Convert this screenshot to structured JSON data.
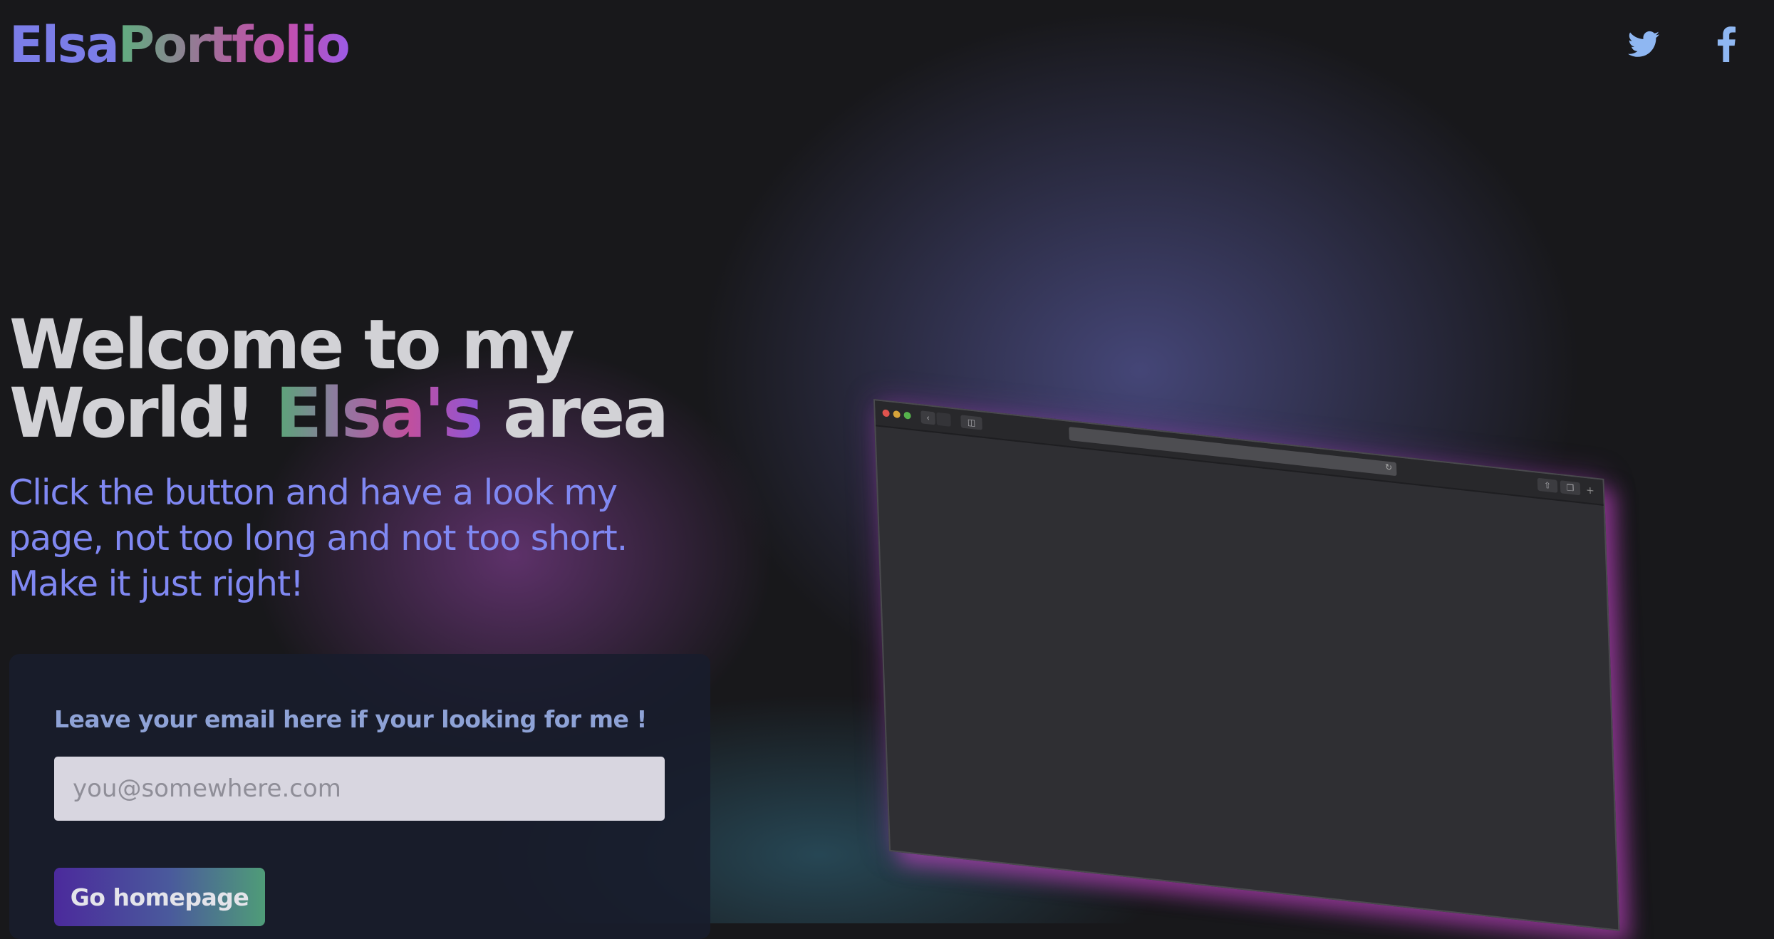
{
  "header": {
    "logo_part1": "Elsa",
    "logo_part2": "Portfolio",
    "social": [
      {
        "name": "twitter",
        "icon": "twitter-bird-icon"
      },
      {
        "name": "facebook",
        "icon": "facebook-f-icon"
      }
    ]
  },
  "hero": {
    "title_line1": "Welcome to my",
    "title_line2_prefix": "World! ",
    "title_highlight": "Elsa's",
    "title_line2_suffix": " area",
    "subtitle": "Click the button and have a look my page, not too long and not too short. Make it just right!"
  },
  "signup": {
    "label": "Leave your email here if your looking for me !",
    "email_placeholder": "you@somewhere.com",
    "email_value": "",
    "button_label": "Go homepage"
  },
  "colors": {
    "background": "#18181b",
    "accent_blue": "#7b7de8",
    "subtitle": "#8088f2",
    "card_label": "#8ea2d6",
    "twitter_icon": "#8fb7f2",
    "facebook_icon": "#8fb7f2"
  },
  "browser_mockup": {
    "icons": [
      "window-close-dot",
      "window-minimize-dot",
      "window-maximize-dot",
      "back-arrow-icon",
      "forward-arrow-icon",
      "sidebar-icon",
      "reload-icon",
      "share-icon",
      "tabs-icon",
      "new-tab-plus-icon"
    ]
  }
}
